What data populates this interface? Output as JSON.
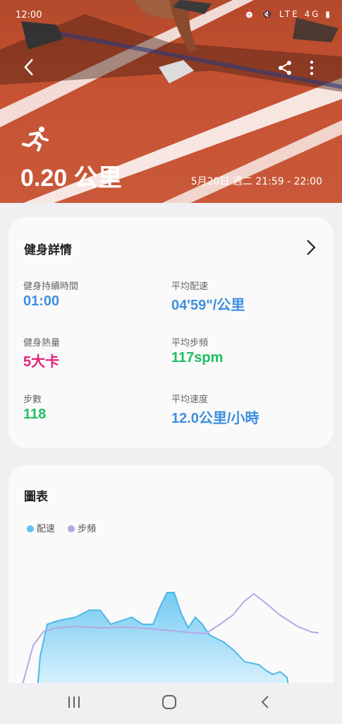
{
  "status": {
    "time": "12:00",
    "icons": "⏰ 🔇 LTE 4G ▮"
  },
  "hero": {
    "distance": "0.20 公里",
    "date_range": "5月20日 週二 21:59 - 22:00"
  },
  "details": {
    "title": "健身詳情",
    "stats": [
      {
        "label": "健身持續時間",
        "value": "01:00"
      },
      {
        "label": "平均配速",
        "value": "04'59\"/公里"
      },
      {
        "label": "健身熱量",
        "value": "5大卡"
      },
      {
        "label": "平均步頻",
        "value": "117spm"
      },
      {
        "label": "步數",
        "value": "118"
      },
      {
        "label": "平均速度",
        "value": "12.0公里/小時"
      }
    ]
  },
  "chart": {
    "title": "圖表",
    "legend": [
      {
        "name": "配速",
        "color": "#5ec3f2"
      },
      {
        "name": "步頻",
        "color": "#b9a6e6"
      }
    ]
  },
  "colors": {
    "accent_blue": "#3d8fe0",
    "calorie_pink": "#e3217c",
    "steps_green": "#1fbf62"
  }
}
